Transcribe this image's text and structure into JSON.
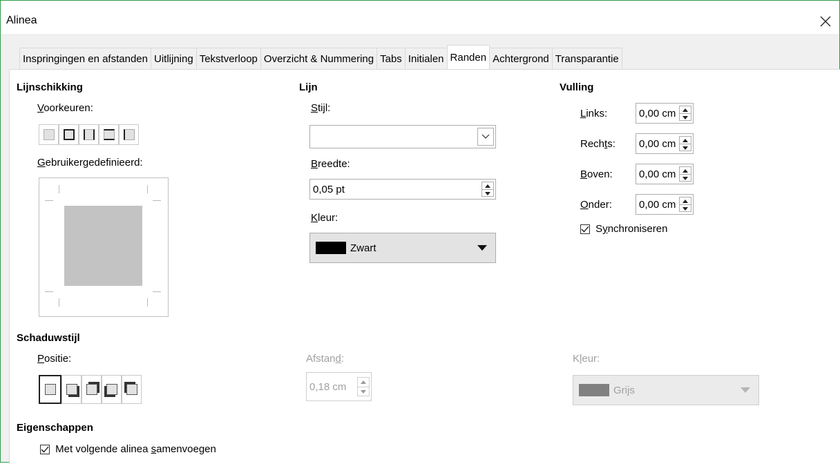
{
  "window": {
    "title": "Alinea",
    "close_icon": "close-icon"
  },
  "tabs": [
    {
      "label": "Inspringingen en afstanden",
      "active": false
    },
    {
      "label": "Uitlijning",
      "active": false
    },
    {
      "label": "Tekstverloop",
      "active": false
    },
    {
      "label": "Overzicht & Nummering",
      "active": false
    },
    {
      "label": "Tabs",
      "active": false
    },
    {
      "label": "Initialen",
      "active": false
    },
    {
      "label": "Randen",
      "active": true
    },
    {
      "label": "Achtergrond",
      "active": false
    },
    {
      "label": "Transparantie",
      "active": false
    }
  ],
  "lijnschikking": {
    "heading": "Lijnschikking",
    "presets_label": "Voorkeuren:",
    "presets_access_key": "V",
    "presets_rest": "oorkeuren:",
    "userdef_access_key": "G",
    "userdef_rest": "ebruikergedefinieerd:"
  },
  "lijn": {
    "heading": "Lijn",
    "style_access_key": "S",
    "style_rest": "tijl:",
    "style_value": "",
    "width_access_key": "B",
    "width_rest": "reedte:",
    "width_value": "0,05 pt",
    "color_access_key": "K",
    "color_rest": "leur:",
    "color_name": "Zwart",
    "color_hex": "#000000"
  },
  "vulling": {
    "heading": "Vulling",
    "left_access_key": "L",
    "left_rest": "inks:",
    "left_value": "0,00 cm",
    "right_pre": "Rech",
    "right_access_key": "t",
    "right_post": "s:",
    "right_value": "0,00 cm",
    "top_access_key": "B",
    "top_rest": "oven:",
    "top_value": "0,00 cm",
    "bottom_access_key": "O",
    "bottom_rest": "nder:",
    "bottom_value": "0,00 cm",
    "sync_pre": "S",
    "sync_access_key": "y",
    "sync_post": "nchroniseren",
    "sync_checked": true
  },
  "schaduw": {
    "heading": "Schaduwstijl",
    "position_access_key": "P",
    "position_rest": "ositie:",
    "distance_pre": "Afstan",
    "distance_access_key": "d",
    "distance_post": ":",
    "distance_value": "0,18 cm",
    "color_pre": "K",
    "color_access_key": "l",
    "color_post": "eur:",
    "color_name": "Grijs",
    "color_hex": "#808080"
  },
  "eigenschappen": {
    "heading": "Eigenschappen",
    "merge_pre": "Met volgende alinea ",
    "merge_access_key": "s",
    "merge_post": "amenvoegen",
    "merge_checked": true
  }
}
